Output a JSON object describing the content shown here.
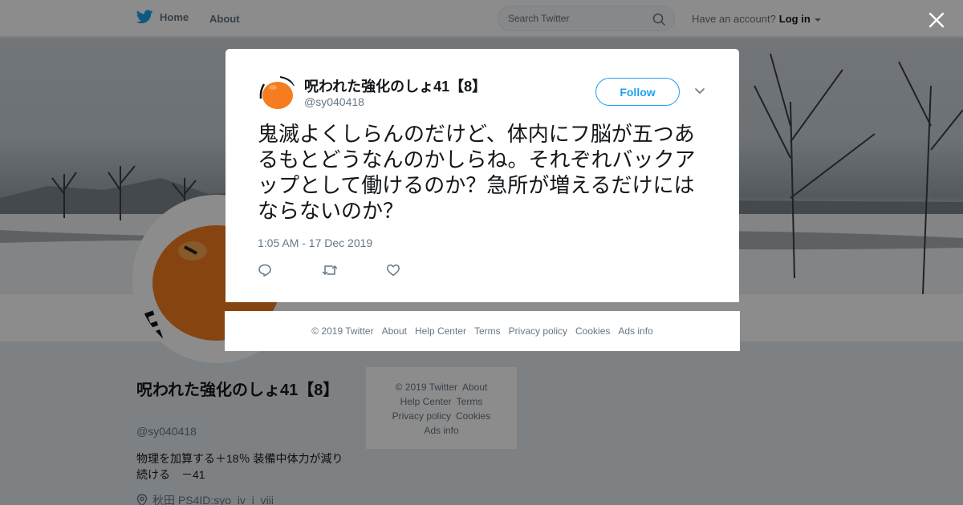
{
  "header": {
    "home_label": "Home",
    "about_label": "About",
    "search_placeholder": "Search Twitter",
    "account_prompt": "Have an account?",
    "login_label": "Log in"
  },
  "profile": {
    "name": "呪われた強化のしょ41【8】",
    "handle": "@sy040418",
    "bio": "物理を加算する＋18％ 装備中体力が減り続ける　－41",
    "location": "秋田 PS4ID:syo_iv_i_viii"
  },
  "side_footer": {
    "links": [
      "© 2019 Twitter",
      "About",
      "Help Center",
      "Terms",
      "Privacy policy",
      "Cookies",
      "Ads info"
    ]
  },
  "modal": {
    "user_name": "呪われた強化のしょ41【8】",
    "user_handle": "@sy040418",
    "follow_label": "Follow",
    "tweet_text": "鬼滅よくしらんのだけど、体内にフ脳が五つあるもとどうなんのかしらね。それぞれバックアップとして働けるのか？急所が増えるだけにはならないのか？",
    "timestamp": "1:05 AM - 17 Dec 2019"
  },
  "modal_footer": {
    "links": [
      "© 2019 Twitter",
      "About",
      "Help Center",
      "Terms",
      "Privacy policy",
      "Cookies",
      "Ads info"
    ]
  },
  "colors": {
    "accent": "#1da1f2",
    "avatar_orange": "#f57c1f",
    "text_secondary": "#657786"
  },
  "icons": {
    "logo": "twitter-bird-icon",
    "search": "search-icon",
    "close": "close-icon",
    "reply": "reply-icon",
    "retweet": "retweet-icon",
    "like": "heart-icon",
    "menu": "chevron-down-icon",
    "location": "location-pin-icon"
  }
}
